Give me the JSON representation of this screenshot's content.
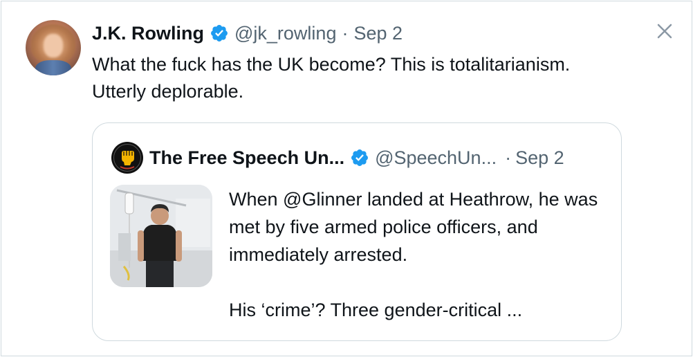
{
  "tweet": {
    "author_name": "J.K. Rowling",
    "author_handle": "@jk_rowling",
    "separator": "·",
    "date": "Sep 2",
    "text": "What the fuck has the UK become? This is totalitarianism. Utterly deplorable.",
    "verified_icon": "verified-badge-icon",
    "close_icon": "close-icon"
  },
  "quoted_tweet": {
    "author_name": "The Free Speech Un...",
    "author_handle": "@SpeechUn...",
    "separator": "·",
    "date": "Sep 2",
    "paragraph1": "When @Glinner landed at Heathrow, he was met by five armed police officers, and immediately arrested.",
    "paragraph2": "His ‘crime’? Three gender-critical ...",
    "verified_icon": "verified-badge-icon"
  },
  "colors": {
    "text": "#0f1419",
    "secondary_text": "#536471",
    "border": "#cfd9de",
    "verified_blue": "#1d9bf0",
    "fist_yellow": "#f4b400"
  }
}
